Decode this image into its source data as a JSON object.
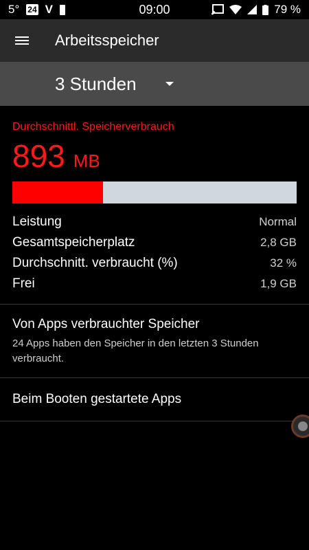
{
  "statusbar": {
    "temp": "5°",
    "calendar_day": "24",
    "app_letter": "V",
    "time": "09:00",
    "battery_percent": "79 %"
  },
  "appbar": {
    "title": "Arbeitsspeicher"
  },
  "spinner": {
    "value": "3 Stunden"
  },
  "summary": {
    "label": "Durchschnittl. Speicherverbrauch",
    "value": "893",
    "unit": "MB",
    "usage_fraction": 0.32
  },
  "stats": [
    {
      "label": "Leistung",
      "value": "Normal"
    },
    {
      "label": "Gesamtspeicherplatz",
      "value": "2,8 GB"
    },
    {
      "label": "Durchschnitt. verbraucht (%)",
      "value": "32 %"
    },
    {
      "label": "Frei",
      "value": "1,9 GB"
    }
  ],
  "items": {
    "apps_title": "Von Apps verbrauchter Speicher",
    "apps_sub": "24 Apps haben den Speicher in den letzten 3 Stunden verbraucht.",
    "boot_title": "Beim Booten gestartete Apps"
  },
  "colors": {
    "accent_red": "#ff0000",
    "bar_track": "#cfd8dc"
  }
}
